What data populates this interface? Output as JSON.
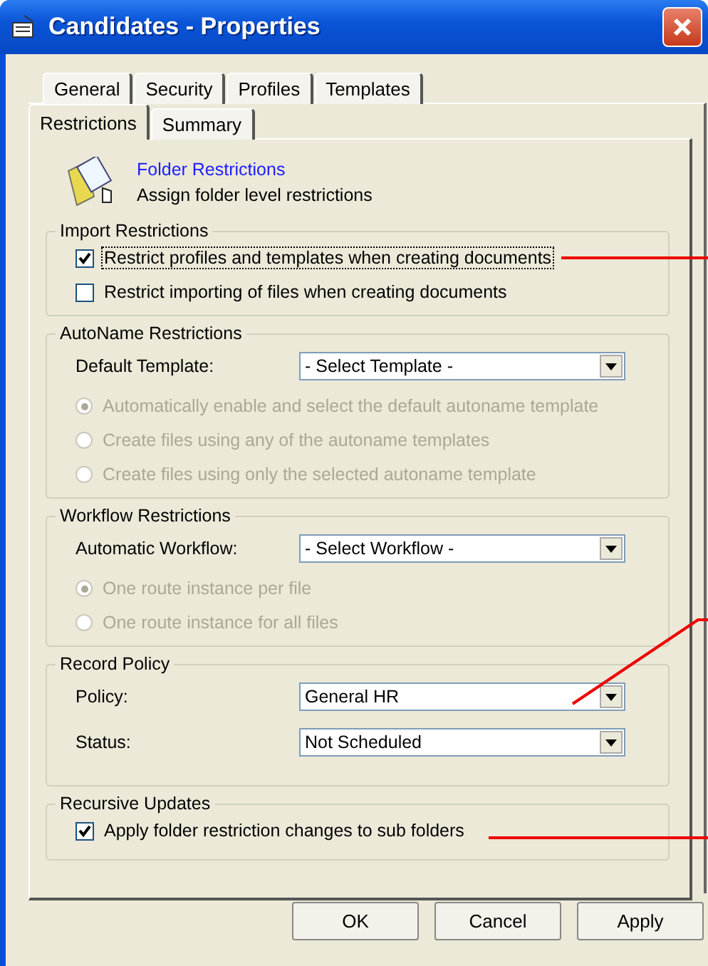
{
  "window": {
    "title": "Candidates - Properties"
  },
  "tab_rows": [
    [
      {
        "label": "General",
        "selected": false
      },
      {
        "label": "Security",
        "selected": false
      },
      {
        "label": "Profiles",
        "selected": false
      },
      {
        "label": "Templates",
        "selected": false
      }
    ],
    [
      {
        "label": "Restrictions",
        "selected": true
      },
      {
        "label": "Summary",
        "selected": false
      }
    ]
  ],
  "header": {
    "title": "Folder Restrictions",
    "subtitle": "Assign folder level restrictions"
  },
  "import_restrictions": {
    "title": "Import Restrictions",
    "options": [
      {
        "label": "Restrict profiles and templates when creating documents",
        "checked": true,
        "focused": true
      },
      {
        "label": "Restrict importing of files when creating documents",
        "checked": false,
        "focused": false
      }
    ]
  },
  "autoname_restrictions": {
    "title": "AutoName Restrictions",
    "field": {
      "label": "Default Template:",
      "value": "- Select Template -"
    },
    "disabled": true,
    "options": [
      {
        "label": "Automatically enable and select the default autoname template",
        "selected": true
      },
      {
        "label": "Create files using any of the autoname templates",
        "selected": false
      },
      {
        "label": "Create files using only the selected autoname template",
        "selected": false
      }
    ]
  },
  "workflow_restrictions": {
    "title": "Workflow Restrictions",
    "field": {
      "label": "Automatic Workflow:",
      "value": "- Select Workflow -"
    },
    "disabled": true,
    "options": [
      {
        "label": "One route instance per file",
        "selected": true
      },
      {
        "label": "One route instance for all files",
        "selected": false
      }
    ]
  },
  "record_policy": {
    "title": "Record Policy",
    "fields": [
      {
        "label": "Policy:",
        "value": "General HR"
      },
      {
        "label": "Status:",
        "value": "Not Scheduled"
      }
    ]
  },
  "recursive_updates": {
    "title": "Recursive Updates",
    "options": [
      {
        "label": "Apply folder restriction changes to sub folders",
        "checked": true,
        "focused": false
      }
    ]
  },
  "buttons": [
    "OK",
    "Cancel",
    "Apply"
  ]
}
